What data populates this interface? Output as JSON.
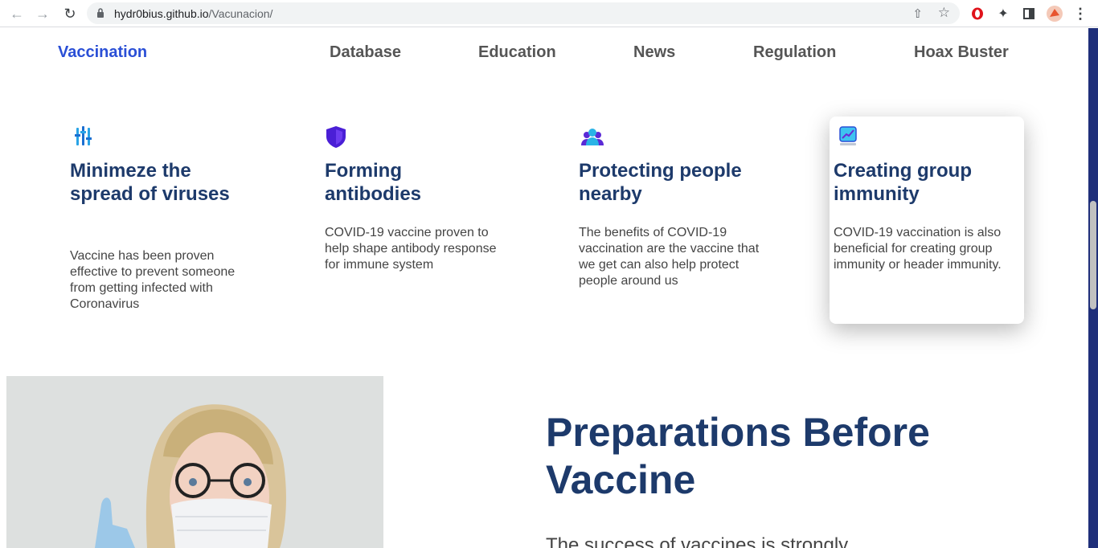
{
  "browser": {
    "url_host": "hydr0bius.github.io",
    "url_path": "/Vacunacion/"
  },
  "nav": {
    "brand": "Vaccination",
    "links": [
      "Database",
      "Education",
      "News",
      "Regulation",
      "Hoax Buster"
    ]
  },
  "features": [
    {
      "icon": "vaccine-tubes-icon",
      "title": "Minimeze the spread of viruses",
      "text": "Vaccine has been proven effective to prevent someone from getting infected with Coronavirus"
    },
    {
      "icon": "shield-icon",
      "title": "Forming antibodies",
      "text": "COVID-19 vaccine proven to help shape antibody response for immune system"
    },
    {
      "icon": "people-group-icon",
      "title": "Protecting people nearby",
      "text": "The benefits of COVID-19 vaccination are the vaccine that we get can also help protect people around us"
    },
    {
      "icon": "chart-growth-icon",
      "title": "Creating group immunity",
      "text": "COVID-19 vaccination is also beneficial for creating group immunity or header immunity."
    }
  ],
  "section": {
    "title": "Preparations Before Vaccine",
    "text": "The success of vaccines is strongly"
  },
  "colors": {
    "brand": "#2a4fd6",
    "heading": "#1d3a6b",
    "scrollbar_track": "#1f2f7a"
  }
}
